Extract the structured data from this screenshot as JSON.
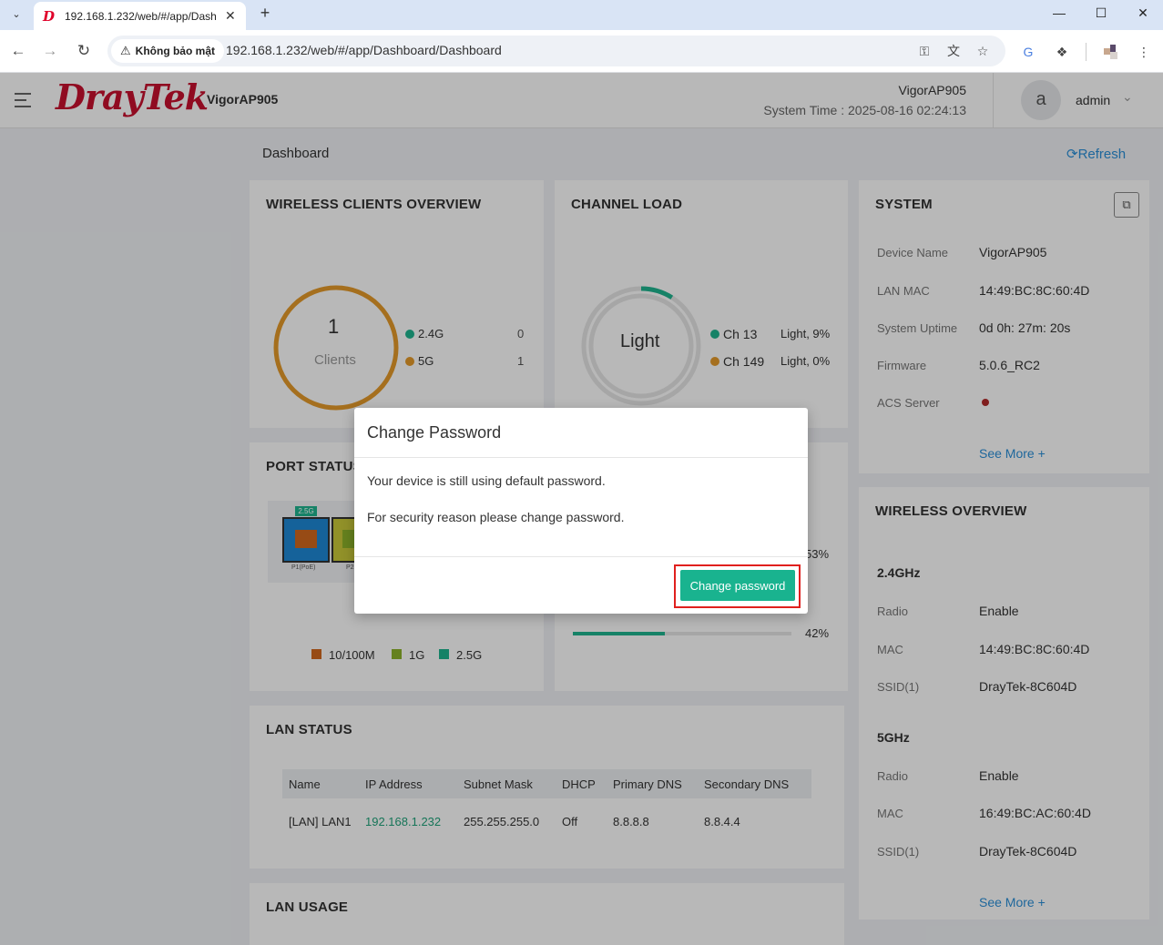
{
  "browser": {
    "tab_title": "192.168.1.232/web/#/app/Dash",
    "security_label": "Không bảo mật",
    "url": "192.168.1.232/web/#/app/Dashboard/Dashboard"
  },
  "header": {
    "logo": "DrayTek",
    "model": "VigorAP905",
    "device_name": "VigorAP905",
    "system_time": "System Time : 2025-08-16 02:24:13",
    "avatar_letter": "a",
    "username": "admin"
  },
  "dashboard": {
    "title": "Dashboard",
    "refresh_label": "Refresh"
  },
  "wireless_clients": {
    "title": "WIRELESS CLIENTS OVERVIEW",
    "total": "1",
    "total_label": "Clients",
    "bands": [
      {
        "name": "2.4G",
        "count": "0",
        "color": "#1fb58f"
      },
      {
        "name": "5G",
        "count": "1",
        "color": "#e59a2a"
      }
    ]
  },
  "channel_load": {
    "title": "CHANNEL LOAD",
    "center_label": "Light",
    "channels": [
      {
        "name": "Ch 13",
        "status": "Light, 9%",
        "color": "#1fb58f",
        "load": 0.09
      },
      {
        "name": "Ch 149",
        "status": "Light, 0%",
        "color": "#e59a2a",
        "load": 0.0
      }
    ],
    "bars": [
      {
        "percent": "53%"
      },
      {
        "percent": "42%",
        "fill": 0.42
      }
    ]
  },
  "port_status": {
    "title": "PORT STATUS",
    "ports": [
      {
        "badge": "2.5G",
        "label": "P1(PoE)"
      },
      {
        "label": "P2"
      }
    ],
    "legend": [
      {
        "label": "10/100M",
        "color": "#d2691e"
      },
      {
        "label": "1G",
        "color": "#8db32a"
      },
      {
        "label": "2.5G",
        "color": "#1fb58f"
      }
    ]
  },
  "system": {
    "title": "SYSTEM",
    "rows": [
      {
        "label": "Device Name",
        "value": "VigorAP905"
      },
      {
        "label": "LAN MAC",
        "value": "14:49:BC:8C:60:4D"
      },
      {
        "label": "System Uptime",
        "value": "0d 0h: 27m: 20s"
      },
      {
        "label": "Firmware",
        "value": "5.0.6_RC2"
      },
      {
        "label": "ACS Server",
        "value": ""
      }
    ],
    "see_more": "See More"
  },
  "wireless_overview": {
    "title": "WIRELESS OVERVIEW",
    "band_24": {
      "name": "2.4GHz",
      "radio_label": "Radio",
      "radio": "Enable",
      "mac_label": "MAC",
      "mac": "14:49:BC:8C:60:4D",
      "ssid_label": "SSID(1)",
      "ssid": "DrayTek-8C604D"
    },
    "band_5": {
      "name": "5GHz",
      "radio_label": "Radio",
      "radio": "Enable",
      "mac_label": "MAC",
      "mac": "16:49:BC:AC:60:4D",
      "ssid_label": "SSID(1)",
      "ssid": "DrayTek-8C604D"
    },
    "see_more": "See More"
  },
  "lan_status": {
    "title": "LAN STATUS",
    "headers": [
      "Name",
      "IP Address",
      "Subnet Mask",
      "DHCP",
      "Primary DNS",
      "Secondary DNS"
    ],
    "rows": [
      [
        "[LAN] LAN1",
        "192.168.1.232",
        "255.255.255.0",
        "Off",
        "8.8.8.8",
        "8.8.4.4"
      ]
    ]
  },
  "lan_usage": {
    "title": "LAN USAGE"
  },
  "modal": {
    "title": "Change Password",
    "message1": "Your device is still using default password.",
    "message2": "For security reason please change password.",
    "button": "Change password"
  }
}
